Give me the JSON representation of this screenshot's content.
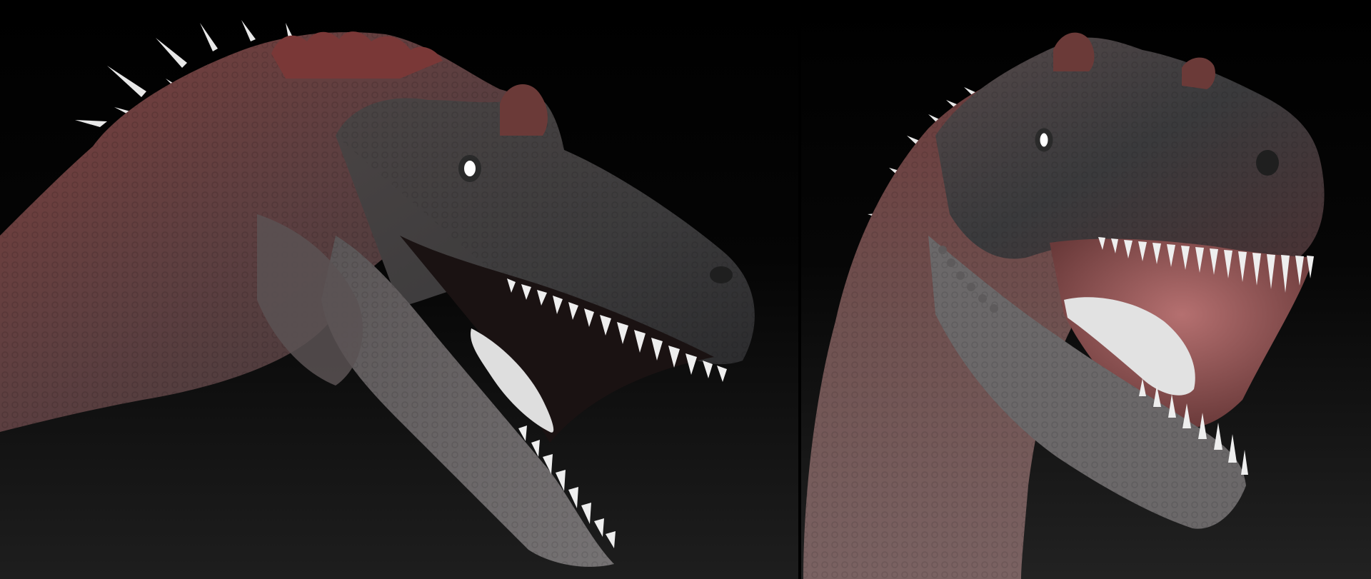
{
  "scene": {
    "panels": [
      {
        "id": "left",
        "view": "side-profile"
      },
      {
        "id": "right",
        "view": "three-quarter-front"
      }
    ],
    "colors": {
      "skin_gray": "#4a4a4a",
      "skin_light_gray": "#777777",
      "skin_red": "#6e3b3a",
      "teeth": "#eeeeee",
      "tongue": "#dcdcdc",
      "mouth_interior": "#8c4d4d",
      "eye": "#ffffff"
    }
  }
}
